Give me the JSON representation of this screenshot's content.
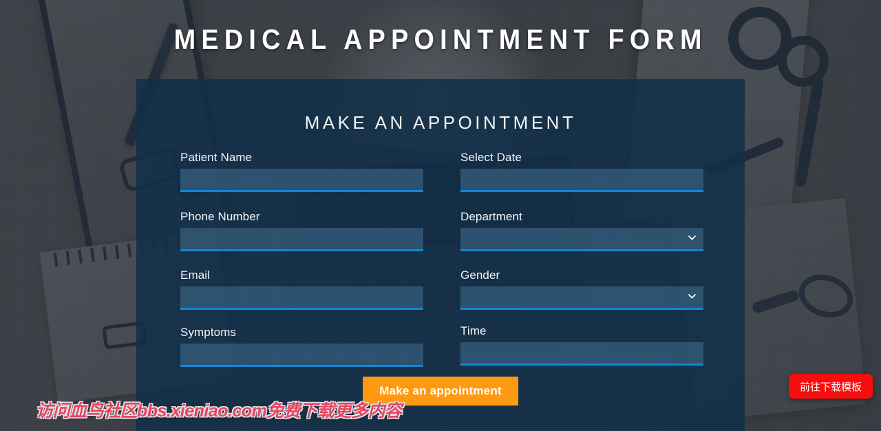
{
  "header": {
    "title": "MEDICAL APPOINTMENT FORM"
  },
  "panel": {
    "title": "MAKE AN APPOINTMENT",
    "fields": {
      "patient_name": {
        "label": "Patient Name",
        "value": "",
        "placeholder": ""
      },
      "phone_number": {
        "label": "Phone Number",
        "value": "",
        "placeholder": ""
      },
      "email": {
        "label": "Email",
        "value": "",
        "placeholder": ""
      },
      "symptoms": {
        "label": "Symptoms",
        "value": "",
        "placeholder": ""
      },
      "select_date": {
        "label": "Select Date",
        "value": "",
        "placeholder": ""
      },
      "department": {
        "label": "Department",
        "value": "",
        "placeholder": ""
      },
      "gender": {
        "label": "Gender",
        "value": "",
        "placeholder": ""
      },
      "time": {
        "label": "Time",
        "value": "",
        "placeholder": ""
      }
    },
    "submit_label": "Make an appointment"
  },
  "watermark": {
    "text": "访问血鸟社区bbs.xieniao.com免费下载更多内容"
  },
  "download_button": {
    "label": "前往下载模板"
  },
  "icons": {
    "department_chevron": "chevron-down-icon",
    "gender_chevron": "chevron-down-icon"
  },
  "colors": {
    "panel_overlay": "#102e48",
    "input_fill": "#385f7e",
    "input_underline": "#1187d8",
    "submit_orange": "#ff9912",
    "download_red": "#f70d0d",
    "watermark_red": "#e8455f",
    "title_white": "#ffffff"
  }
}
